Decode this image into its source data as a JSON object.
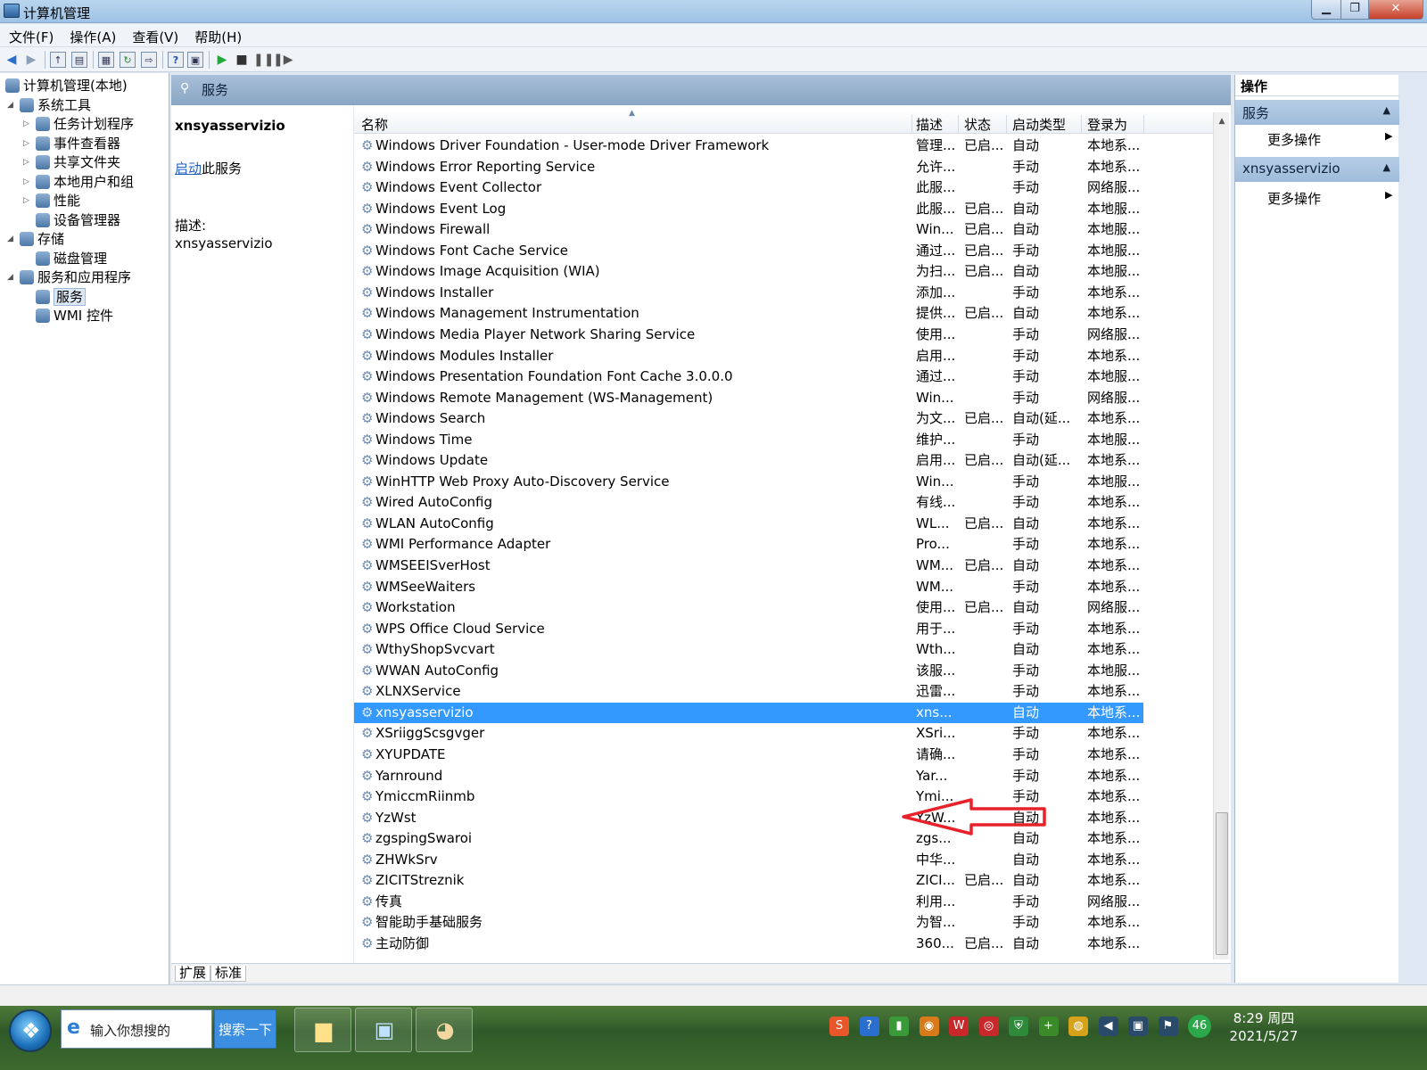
{
  "window": {
    "title": "计算机管理",
    "controls": {
      "minimize": "▁",
      "maximize": "❐",
      "close": "✕"
    }
  },
  "menu": [
    "文件(F)",
    "操作(A)",
    "查看(V)",
    "帮助(H)"
  ],
  "toolbar_icons": [
    "back-icon",
    "forward-icon",
    "up-folder-icon",
    "show-tree-icon",
    "properties-icon",
    "refresh-icon",
    "export-icon",
    "help-icon",
    "view-icon",
    "play-icon",
    "stop-icon",
    "pause-icon",
    "restart-icon"
  ],
  "tree": [
    {
      "label": "计算机管理(本地)",
      "level": 0,
      "expander": "",
      "icon": "computer-mgmt-icon"
    },
    {
      "label": "系统工具",
      "level": 1,
      "expander": "◢",
      "icon": "tools-icon"
    },
    {
      "label": "任务计划程序",
      "level": 2,
      "expander": "▷",
      "icon": "clock-icon"
    },
    {
      "label": "事件查看器",
      "level": 2,
      "expander": "▷",
      "icon": "event-viewer-icon"
    },
    {
      "label": "共享文件夹",
      "level": 2,
      "expander": "▷",
      "icon": "shared-folder-icon"
    },
    {
      "label": "本地用户和组",
      "level": 2,
      "expander": "▷",
      "icon": "users-icon"
    },
    {
      "label": "性能",
      "level": 2,
      "expander": "▷",
      "icon": "performance-icon"
    },
    {
      "label": "设备管理器",
      "level": 2,
      "expander": "",
      "icon": "device-manager-icon"
    },
    {
      "label": "存储",
      "level": 1,
      "expander": "◢",
      "icon": "storage-icon"
    },
    {
      "label": "磁盘管理",
      "level": 2,
      "expander": "",
      "icon": "disk-icon"
    },
    {
      "label": "服务和应用程序",
      "level": 1,
      "expander": "◢",
      "icon": "services-apps-icon"
    },
    {
      "label": "服务",
      "level": 2,
      "expander": "",
      "icon": "services-icon",
      "selected": true
    },
    {
      "label": "WMI 控件",
      "level": 2,
      "expander": "",
      "icon": "wmi-icon"
    }
  ],
  "middle": {
    "header_title": "服务",
    "detail": {
      "service_name": "xnsyasservizio",
      "start_link": "启动",
      "start_suffix": "此服务",
      "desc_label": "描述:",
      "desc_value": "xnsyasservizio"
    },
    "columns": [
      "名称",
      "描述",
      "状态",
      "启动类型",
      "登录为"
    ],
    "rows": [
      [
        "Windows Driver Foundation - User-mode Driver Framework",
        "管理...",
        "已启...",
        "自动",
        "本地系..."
      ],
      [
        "Windows Error Reporting Service",
        "允许...",
        "",
        "手动",
        "本地系..."
      ],
      [
        "Windows Event Collector",
        "此服...",
        "",
        "手动",
        "网络服..."
      ],
      [
        "Windows Event Log",
        "此服...",
        "已启...",
        "自动",
        "本地服..."
      ],
      [
        "Windows Firewall",
        "Win...",
        "已启...",
        "自动",
        "本地服..."
      ],
      [
        "Windows Font Cache Service",
        "通过...",
        "已启...",
        "手动",
        "本地服..."
      ],
      [
        "Windows Image Acquisition (WIA)",
        "为扫...",
        "已启...",
        "自动",
        "本地服..."
      ],
      [
        "Windows Installer",
        "添加...",
        "",
        "手动",
        "本地系..."
      ],
      [
        "Windows Management Instrumentation",
        "提供...",
        "已启...",
        "自动",
        "本地系..."
      ],
      [
        "Windows Media Player Network Sharing Service",
        "使用...",
        "",
        "手动",
        "网络服..."
      ],
      [
        "Windows Modules Installer",
        "启用...",
        "",
        "手动",
        "本地系..."
      ],
      [
        "Windows Presentation Foundation Font Cache 3.0.0.0",
        "通过...",
        "",
        "手动",
        "本地服..."
      ],
      [
        "Windows Remote Management (WS-Management)",
        "Win...",
        "",
        "手动",
        "网络服..."
      ],
      [
        "Windows Search",
        "为文...",
        "已启...",
        "自动(延...",
        "本地系..."
      ],
      [
        "Windows Time",
        "维护...",
        "",
        "手动",
        "本地服..."
      ],
      [
        "Windows Update",
        "启用...",
        "已启...",
        "自动(延...",
        "本地系..."
      ],
      [
        "WinHTTP Web Proxy Auto-Discovery Service",
        "Win...",
        "",
        "手动",
        "本地服..."
      ],
      [
        "Wired AutoConfig",
        "有线...",
        "",
        "手动",
        "本地系..."
      ],
      [
        "WLAN AutoConfig",
        "WL...",
        "已启...",
        "自动",
        "本地系..."
      ],
      [
        "WMI Performance Adapter",
        "Pro...",
        "",
        "手动",
        "本地系..."
      ],
      [
        "WMSEEISverHost",
        "WM...",
        "已启...",
        "自动",
        "本地系..."
      ],
      [
        "WMSeeWaiters",
        "WM...",
        "",
        "手动",
        "本地系..."
      ],
      [
        "Workstation",
        "使用...",
        "已启...",
        "自动",
        "网络服..."
      ],
      [
        "WPS Office Cloud Service",
        "用于...",
        "",
        "手动",
        "本地系..."
      ],
      [
        "WthyShopSvcvart",
        "Wth...",
        "",
        "自动",
        "本地系..."
      ],
      [
        "WWAN AutoConfig",
        "该服...",
        "",
        "手动",
        "本地服..."
      ],
      [
        "XLNXService",
        "迅雷...",
        "",
        "手动",
        "本地系..."
      ],
      [
        "xnsyasservizio",
        "xns...",
        "",
        "自动",
        "本地系..."
      ],
      [
        "XSriiggScsgvger",
        "XSri...",
        "",
        "手动",
        "本地系..."
      ],
      [
        "XYUPDATE",
        "请确...",
        "",
        "手动",
        "本地系..."
      ],
      [
        "Yarnround",
        "Yar...",
        "",
        "手动",
        "本地系..."
      ],
      [
        "YmiccmRiinmb",
        "Ymi...",
        "",
        "手动",
        "本地系..."
      ],
      [
        "YzWst",
        "YzW...",
        "",
        "自动",
        "本地系..."
      ],
      [
        "zgspingSwaroi",
        "zgs...",
        "",
        "自动",
        "本地系..."
      ],
      [
        "ZHWkSrv",
        "中华...",
        "",
        "自动",
        "本地系..."
      ],
      [
        "ZICITStreznik",
        "ZICI...",
        "已启...",
        "自动",
        "本地系..."
      ],
      [
        "传真",
        "利用...",
        "",
        "手动",
        "网络服..."
      ],
      [
        "智能助手基础服务",
        "为智...",
        "",
        "手动",
        "本地系..."
      ],
      [
        "主动防御",
        "360...",
        "已启...",
        "自动",
        "本地系..."
      ]
    ],
    "selected_row": 27,
    "tabs": [
      "扩展",
      "标准"
    ]
  },
  "actions": {
    "header": "操作",
    "sections": [
      {
        "title": "服务",
        "item": "更多操作"
      },
      {
        "title": "xnsyasservizio",
        "item": "更多操作"
      }
    ]
  },
  "taskbar": {
    "search_placeholder": "输入你想搜的",
    "search_button": "搜索一下",
    "apps": [
      "folder-icon",
      "computer-mgmt-icon",
      "paint-icon"
    ],
    "clock_time": "8:29 周四",
    "clock_date": "2021/5/27",
    "tray": [
      {
        "name": "sogou-icon",
        "glyph": "S",
        "color": "#e8562a"
      },
      {
        "name": "help-circle-icon",
        "glyph": "?",
        "color": "#2a6fd0"
      },
      {
        "name": "battery-icon",
        "glyph": "▮",
        "color": "#3a9a3a"
      },
      {
        "name": "qq-icon",
        "glyph": "◉",
        "color": "#d97a1a"
      },
      {
        "name": "wps-icon",
        "glyph": "W",
        "color": "#c8282a"
      },
      {
        "name": "netease-icon",
        "glyph": "◎",
        "color": "#c8282a"
      },
      {
        "name": "shield-icon",
        "glyph": "⛨",
        "color": "#2e8a3a"
      },
      {
        "name": "plus-icon",
        "glyph": "+",
        "color": "#3a8a2a"
      },
      {
        "name": "security-icon",
        "glyph": "◍",
        "color": "#d6a21a"
      },
      {
        "name": "volume-icon",
        "glyph": "◀",
        "color": "#2a4a6a"
      },
      {
        "name": "network-icon",
        "glyph": "▣",
        "color": "#2a4a6a"
      },
      {
        "name": "flag-icon",
        "glyph": "⚑",
        "color": "#2a4a6a"
      },
      {
        "name": "badge-icon",
        "glyph": "46",
        "color": "#2aa84a"
      }
    ]
  }
}
